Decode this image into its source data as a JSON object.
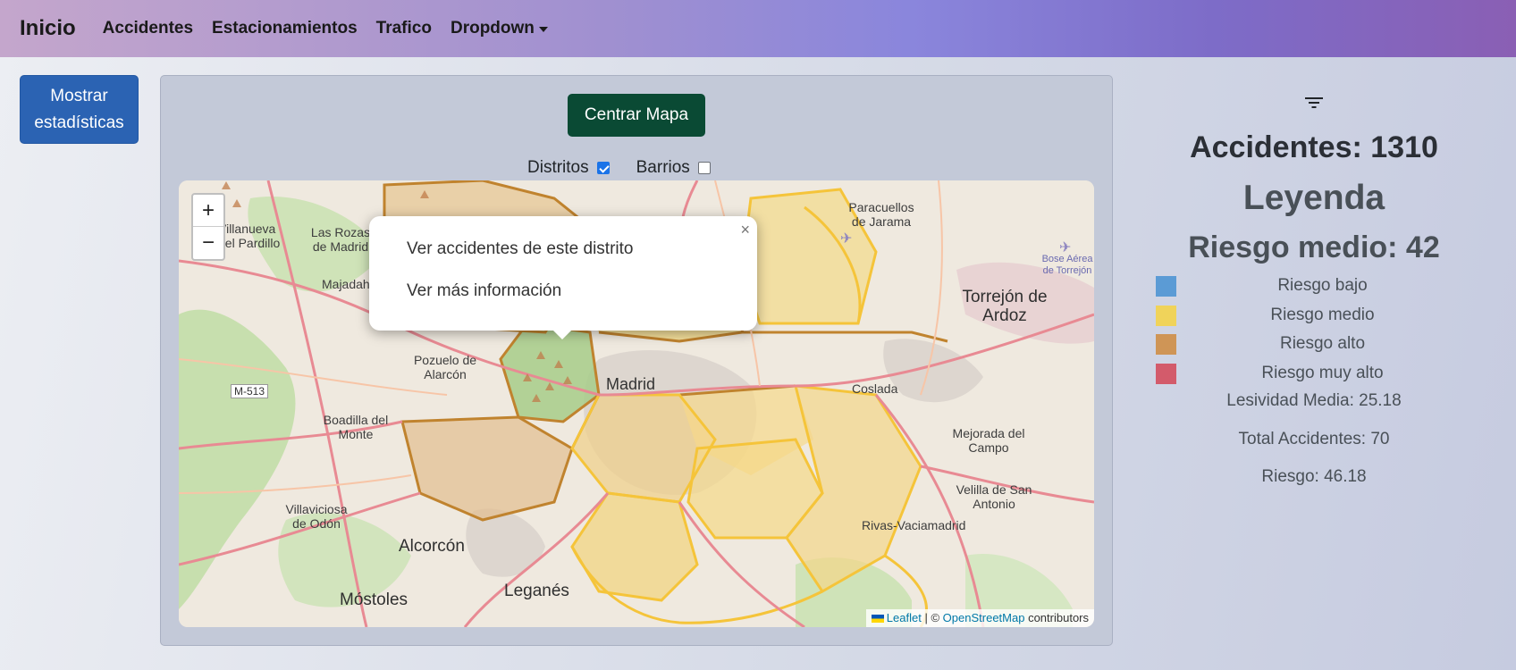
{
  "navbar": {
    "brand": "Inicio",
    "links": [
      "Accidentes",
      "Estacionamientos",
      "Trafico",
      "Dropdown"
    ]
  },
  "stats_button": {
    "label": "Mostrar estadísticas"
  },
  "map_panel": {
    "center_button": "Centrar Mapa",
    "toggles": [
      {
        "label": "Distritos",
        "checked": true
      },
      {
        "label": "Barrios",
        "checked": false
      }
    ],
    "zoom": {
      "in": "+",
      "out": "−"
    },
    "popup": {
      "close": "×",
      "links": [
        "Ver accidentes de este distrito",
        "Ver más información"
      ]
    },
    "attribution": {
      "leaflet": "Leaflet",
      "sep": "| ©",
      "osm": "OpenStreetMap",
      "suffix": "contributors"
    },
    "places": {
      "madrid": "Madrid",
      "torrejon": "Torrejón de Ardoz",
      "alcorcon": "Alcorcón",
      "leganes": "Leganés",
      "mostoles": "Móstoles",
      "pozuelo": "Pozuelo de Alarcón",
      "boadilla": "Boadilla del Monte",
      "coslada": "Coslada",
      "mejorada": "Mejorada del Campo",
      "velilla": "Velilla de San Antonio",
      "rivas": "Rivas-Vaciamadrid",
      "villaviciosa": "Villaviciosa de Odón",
      "paracuellos": "Paracuellos de Jarama",
      "lasrozas": "Las Rozas de Madrid",
      "majadahonda": "Majadahonda",
      "villanueva": "Villanueva del Pardillo",
      "bose": "Bose Aérea de Torrejón",
      "m513": "M-513"
    }
  },
  "right_panel": {
    "accidents": "Accidentes: 1310",
    "legend_title": "Leyenda",
    "risk_mid": "Riesgo medio: 42",
    "legend": [
      {
        "label": "Riesgo bajo",
        "color": "#5b9bd5"
      },
      {
        "label": "Riesgo medio",
        "color": "#f0d35a"
      },
      {
        "label": "Riesgo alto",
        "color": "#cf9556"
      },
      {
        "label": "Riesgo muy alto",
        "color": "#d35b6b"
      }
    ],
    "lesividad": "Lesividad Media: 25.18",
    "total": "Total Accidentes: 70",
    "riesgo": "Riesgo: 46.18"
  },
  "icons": {
    "filter": "filter-icon",
    "caret": "chevron-down-icon"
  }
}
